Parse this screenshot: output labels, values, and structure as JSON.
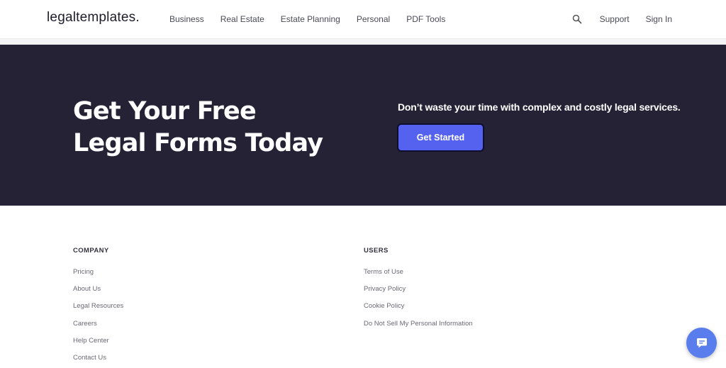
{
  "header": {
    "logo": "legaltemplates.",
    "nav": [
      "Business",
      "Real Estate",
      "Estate Planning",
      "Personal",
      "PDF Tools"
    ],
    "support": "Support",
    "sign_in": "Sign In"
  },
  "hero": {
    "title": "Get Your Free Legal Forms Today",
    "subtitle": "Don’t waste your time with complex and costly legal services.",
    "cta": "Get Started"
  },
  "footer": {
    "company": {
      "heading": "COMPANY",
      "links": [
        "Pricing",
        "About Us",
        "Legal Resources",
        "Careers",
        "Help Center",
        "Contact Us"
      ]
    },
    "users": {
      "heading": "USERS",
      "links": [
        "Terms of Use",
        "Privacy Policy",
        "Cookie Policy",
        "Do Not Sell My Personal Information"
      ]
    }
  },
  "icons": {
    "search": "search-icon",
    "chat": "chat-icon"
  },
  "colors": {
    "hero_bg": "#252236",
    "accent": "#5562f0",
    "chat": "#5a7ded"
  }
}
